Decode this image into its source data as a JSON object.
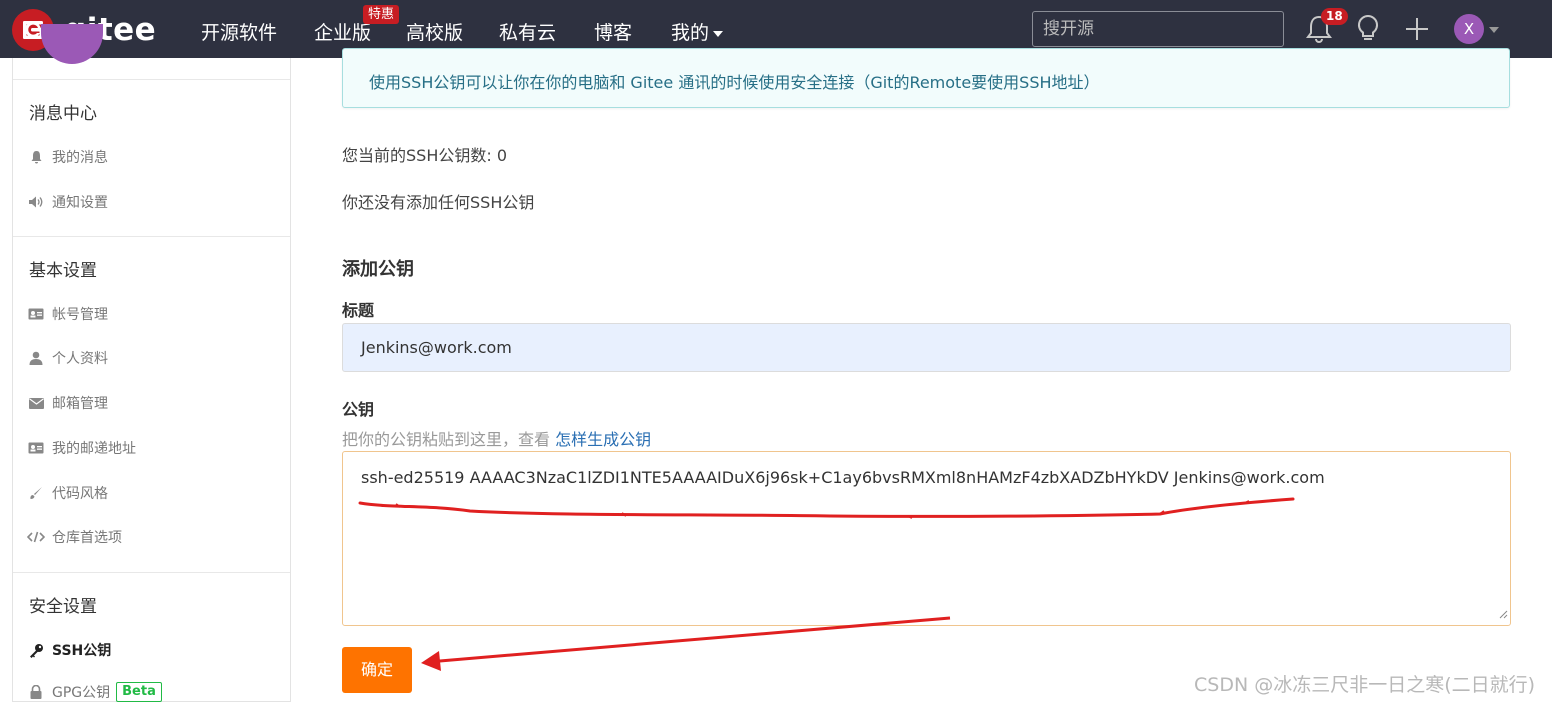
{
  "topnav": {
    "logo_text": "gitee",
    "items": [
      "开源软件",
      "企业版",
      "高校版",
      "私有云",
      "博客",
      "我的"
    ],
    "hot_badge": "特惠",
    "search_placeholder": "搜开源",
    "notification_count": "18",
    "user_initial": "X",
    "bg_color": "#2e3140"
  },
  "sidebar": {
    "sections": [
      {
        "heading": "消息中心",
        "items": [
          {
            "label": "我的消息",
            "icon": "bell-icon"
          },
          {
            "label": "通知设置",
            "icon": "volume-icon"
          }
        ]
      },
      {
        "heading": "基本设置",
        "items": [
          {
            "label": "帐号管理",
            "icon": "id-card-icon"
          },
          {
            "label": "个人资料",
            "icon": "user-icon"
          },
          {
            "label": "邮箱管理",
            "icon": "envelope-icon"
          },
          {
            "label": "我的邮递地址",
            "icon": "address-card-icon"
          },
          {
            "label": "代码风格",
            "icon": "brush-icon"
          },
          {
            "label": "仓库首选项",
            "icon": "code-icon"
          }
        ]
      },
      {
        "heading": "安全设置",
        "items": [
          {
            "label": "SSH公钥",
            "icon": "key-icon",
            "active": true
          },
          {
            "label": "GPG公钥",
            "icon": "lock-icon",
            "badge": "Beta"
          }
        ]
      }
    ]
  },
  "main": {
    "info": "使用SSH公钥可以让你在你的电脑和 Gitee 通讯的时候使用安全连接（Git的Remote要使用SSH地址）",
    "key_count_text": "您当前的SSH公钥数: 0",
    "no_key_text": "你还没有添加任何SSH公钥",
    "add_title": "添加公钥",
    "title_label": "标题",
    "title_value": "Jenkins@work.com",
    "key_label": "公钥",
    "key_hint": "把你的公钥粘贴到这里，查看 ",
    "key_hint_link": "怎样生成公钥",
    "key_value": "ssh-ed25519 AAAAC3NzaC1lZDI1NTE5AAAAIDuX6j96sk+C1ay6bvsRMXml8nHAMzF4zbXADZbHYkDV Jenkins@work.com",
    "confirm_label": "确定"
  },
  "accent_colors": {
    "brand_red": "#c71d23",
    "confirm_orange": "#fe7300",
    "annotation_red": "#e02020"
  },
  "watermark": "CSDN @冰冻三尺非一日之寒(二日就行)"
}
